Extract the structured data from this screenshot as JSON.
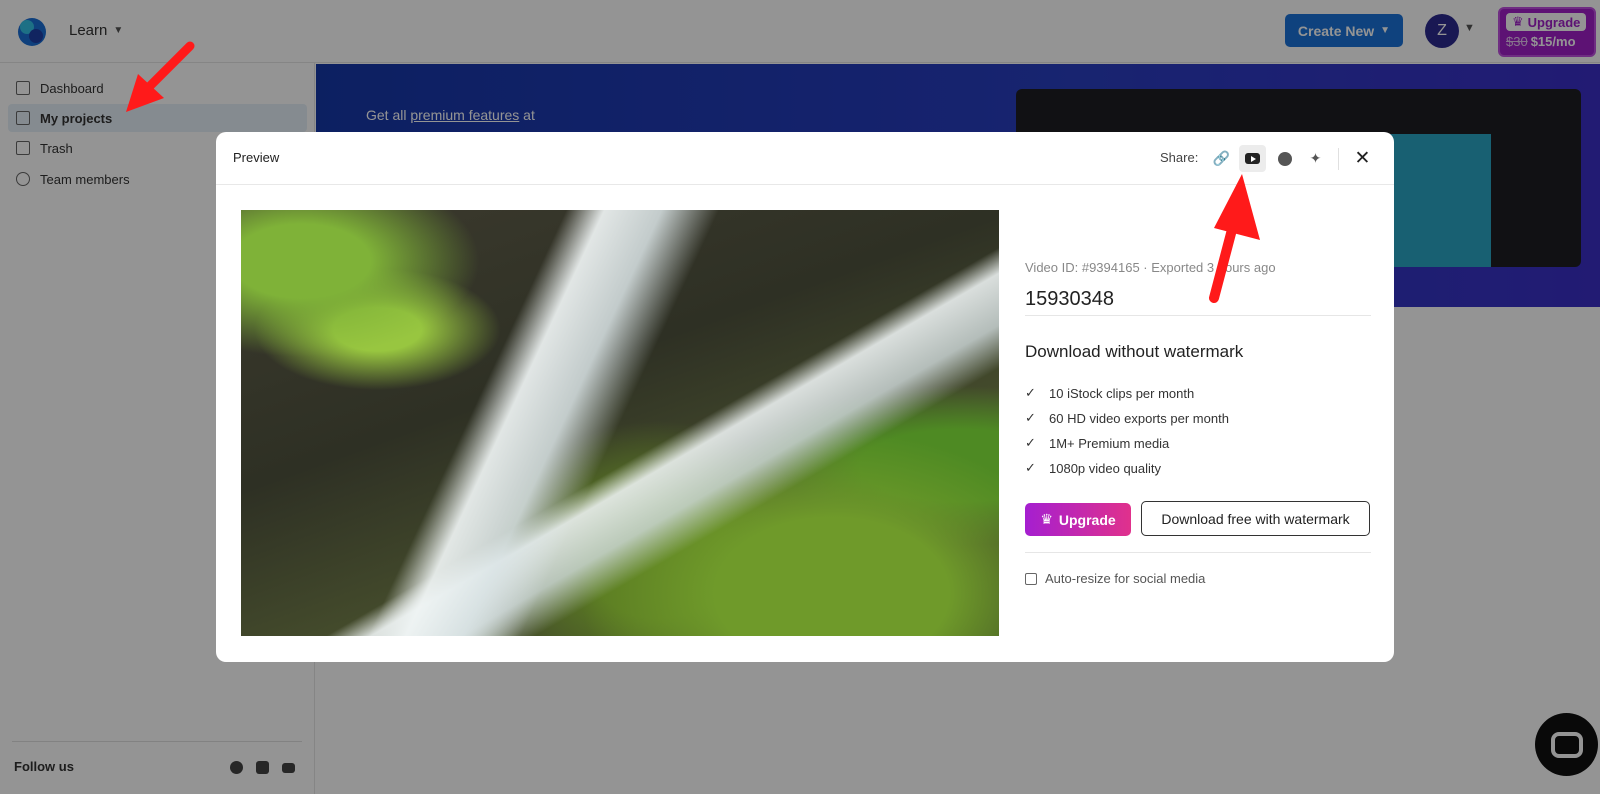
{
  "topbar": {
    "learn_label": "Learn",
    "create_label": "Create New",
    "avatar_letter": "Z",
    "upgrade": {
      "label": "Upgrade",
      "old_price": "$30",
      "new_price": "$15/mo"
    }
  },
  "sidebar": {
    "items": [
      {
        "label": "Dashboard"
      },
      {
        "label": "My projects"
      },
      {
        "label": "Trash"
      },
      {
        "label": "Team members"
      }
    ],
    "follow_label": "Follow us"
  },
  "banner": {
    "text_prefix": "Get all ",
    "text_link": "premium features",
    "text_suffix": " at"
  },
  "modal": {
    "title": "Preview",
    "share_label": "Share:",
    "video_meta": "Video ID: #9394165 · Exported 3 hours ago",
    "video_title": "15930348",
    "download_heading": "Download without watermark",
    "features": [
      "10 iStock clips per month",
      "60 HD video exports per month",
      "1M+ Premium media",
      "1080p video quality"
    ],
    "upgrade_label": "Upgrade",
    "free_label": "Download free with watermark",
    "resize_label": "Auto-resize for social media"
  },
  "colors": {
    "primary": "#1a73d9",
    "upgrade_purple": "#a020c8",
    "banner_blue": "#1637a8",
    "arrow_red": "#ff1a1a"
  }
}
